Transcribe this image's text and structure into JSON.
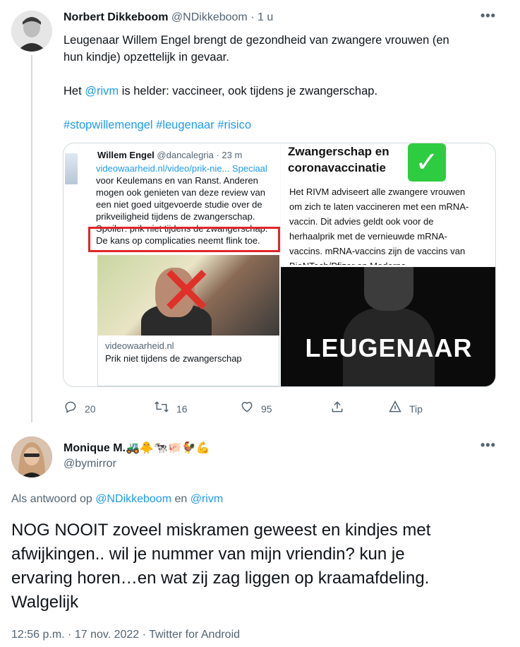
{
  "tweet": {
    "author": {
      "name": "Norbert Dikkeboom",
      "handle": "@NDikkeboom",
      "separator": "·",
      "time": "1 u"
    },
    "more_label": "•••",
    "lines": [
      "Leugenaar Willem Engel brengt de gezondheid van zwangere vrouwen (en",
      "hun kindje) opzettelijk in gevaar."
    ],
    "line2_prefix": "Het ",
    "line2_mention": "@rivm",
    "line2_suffix": " is helder: vaccineer, ook tijdens je zwangerschap.",
    "hashtags": "#stopwillemengel #leugenaar #risico",
    "media": {
      "screenshot": {
        "name": "Willem Engel",
        "handle": "@dancalegria · 23 m",
        "lines": [
          "videowaarheid.nl/video/prik-nie... Speciaal",
          "voor Keulemans en van Ranst. Anderen",
          "mogen ook genieten van deze review van",
          "een niet goed uitgevoerde studie over de",
          "prikveiligheid tijdens de zwangerschap.",
          "Spoiler: prik niet tijdens de zwangerschap.",
          "De kans op complicaties neemt flink toe."
        ],
        "card_domain": "videowaarheid.nl",
        "card_title": "Prik niet tijdens de zwangerschap"
      },
      "info": {
        "title_line1": "Zwangerschap en",
        "title_line2": "coronavaccinatie",
        "check": "✓",
        "lines": [
          "Het RIVM adviseert alle zwangere vrouwen",
          "om zich te laten vaccineren met een mRNA-",
          "vaccin. Dit advies geldt ook voor de",
          "herhaalprik met de vernieuwde mRNA-",
          "vaccins. mRNA-vaccins zijn de vaccins van",
          "BioNTech/Pfizer en Moderna."
        ]
      },
      "portrait_word": "LEUGENAAR"
    },
    "actions": {
      "reply_count": "20",
      "retweet_count": "16",
      "like_count": "95",
      "tip_label": "Tip"
    }
  },
  "reply": {
    "author": {
      "name": "Monique M.",
      "emojis": "🚜🐥🐄🐖🐓💪",
      "handle": "@bymirror"
    },
    "more_label": "•••",
    "reply_prefix": "Als antwoord op ",
    "reply_user1": "@NDikkeboom",
    "reply_join": " en ",
    "reply_user2": "@rivm",
    "text_lines": [
      "NOG NOOIT zoveel miskramen geweest en kindjes met",
      "afwijkingen.. wil je nummer van mijn vriendin? kun je",
      "ervaring horen…en wat zij zag liggen op kraamafdeling.",
      "Walgelijk"
    ],
    "meta": "12:56 p.m. · 17 nov. 2022 · Twitter for Android"
  }
}
